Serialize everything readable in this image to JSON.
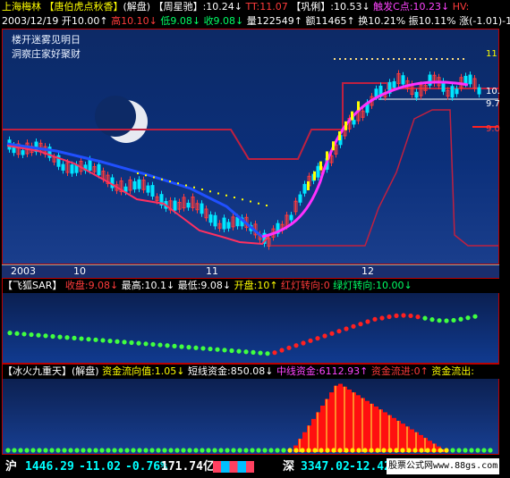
{
  "window": {
    "title": "上海梅林"
  },
  "header": {
    "row1": {
      "indicator1": "【唐伯虎点秋香】",
      "mode1": "(解盘)",
      "indicator2": "【周星驰】",
      "v1": ":10.24↓",
      "tt": "TT:11.07",
      "indicator3": "【巩俐】",
      "v2": ":10.53↓",
      "trigger": "触发C点:10.23↓",
      "hv": "HV:"
    },
    "row2": {
      "date": "2003/12/19",
      "open": "开10.00↑",
      "high": "高10.10↓",
      "low": "低9.08↓",
      "close": "收9.08↓",
      "vol": "量122549↑",
      "amt": "额11465↑",
      "turn": "换10.21%",
      "amp": "振10.11%",
      "chg": "涨(-1.01)-1"
    }
  },
  "poem": {
    "line1": "楼开迷雾见明日",
    "line2": "洞察庄家好聚财"
  },
  "price_axis": {
    "p11": "11",
    "p10": "10.",
    "p97": "9.7",
    "p9": "9.0"
  },
  "date_axis": {
    "d1": "2003",
    "d2": "10",
    "d3": "11",
    "d4": "12"
  },
  "panel2": {
    "name": "【飞狐SAR】",
    "close": "收盘:9.08↓",
    "high": "最高:10.1↓",
    "low": "最低:9.08↓",
    "open": "开盘:10↑",
    "red": "红灯转向:0",
    "green": "绿灯转向:10.00↓"
  },
  "panel3": {
    "name": "【冰火九重天】(解盘)",
    "flow": "资金流向值:1.05↓",
    "short": "短线资金:850.08↓",
    "mid": "中线资金:6112.93↑",
    "in": "资金流进:0↑",
    "out": "资金流出:"
  },
  "status_bar": {
    "sh_label": "沪",
    "sh_index": "1446.29",
    "sh_change": "-11.02",
    "sh_pct": "-0.76%",
    "sh_amount": "171.74亿",
    "sz_label": "深",
    "sz_index": "3347.02",
    "sz_change": "-12.42",
    "watermark": "股票公式网www.88gs.com"
  },
  "colors": {
    "up": "#ff3b3b",
    "down": "#00ffff",
    "accent": "#ffff00",
    "background": "#000000"
  }
}
